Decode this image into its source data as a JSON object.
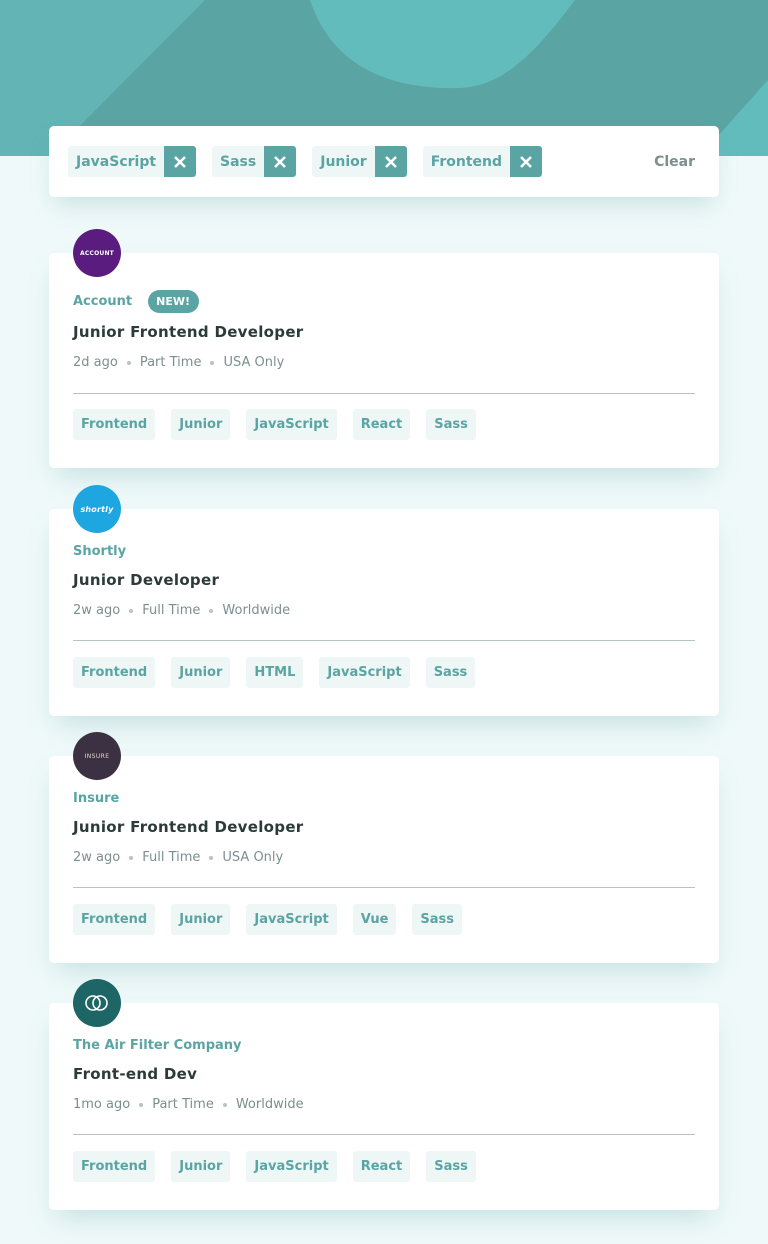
{
  "colors": {
    "accent": "#5ba4a4",
    "background": "#eff9f9",
    "tag_bg": "#eef6f6",
    "heading": "#2c3a3a",
    "muted": "#7c8f8f"
  },
  "filters": {
    "active": [
      "JavaScript",
      "Sass",
      "Junior",
      "Frontend"
    ],
    "remove_icon": "close-icon",
    "clear_label": "Clear"
  },
  "jobs": [
    {
      "company": "Account",
      "logo_text": "ACCOUNT",
      "logo_color": "#5a1c7f",
      "badge": "NEW!",
      "position": "Junior Frontend Developer",
      "posted": "2d ago",
      "contract": "Part Time",
      "location": "USA Only",
      "tags": [
        "Frontend",
        "Junior",
        "JavaScript",
        "React",
        "Sass"
      ]
    },
    {
      "company": "Shortly",
      "logo_text": "shortly",
      "logo_color": "#1ea6e0",
      "badge": "",
      "position": "Junior Developer",
      "posted": "2w ago",
      "contract": "Full Time",
      "location": "Worldwide",
      "tags": [
        "Frontend",
        "Junior",
        "HTML",
        "JavaScript",
        "Sass"
      ]
    },
    {
      "company": "Insure",
      "logo_text": "INSURE",
      "logo_color": "#3c3142",
      "badge": "",
      "position": "Junior Frontend Developer",
      "posted": "2w ago",
      "contract": "Full Time",
      "location": "USA Only",
      "tags": [
        "Frontend",
        "Junior",
        "JavaScript",
        "Vue",
        "Sass"
      ]
    },
    {
      "company": "The Air Filter Company",
      "logo_text": "",
      "logo_color": "#1e6565",
      "badge": "",
      "position": "Front-end Dev",
      "posted": "1mo ago",
      "contract": "Part Time",
      "location": "Worldwide",
      "tags": [
        "Frontend",
        "Junior",
        "JavaScript",
        "React",
        "Sass"
      ]
    }
  ]
}
